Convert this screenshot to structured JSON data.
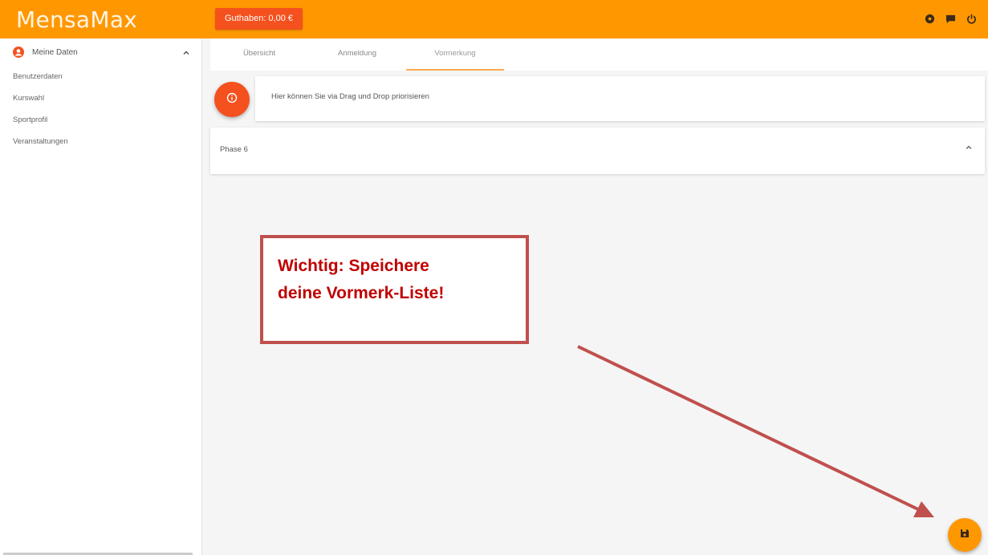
{
  "app": {
    "title": "MensaMax",
    "balance": "Guthaben: 0,00 €"
  },
  "sidebar": {
    "header": "Meine Daten",
    "items": [
      {
        "label": "Benutzerdaten"
      },
      {
        "label": "Kurswahl"
      },
      {
        "label": "Sportprofil"
      },
      {
        "label": "Veranstaltungen"
      }
    ]
  },
  "tabs": [
    {
      "label": "Übersicht"
    },
    {
      "label": "Anmeldung"
    },
    {
      "label": "Vormerkung",
      "active": true
    }
  ],
  "info": {
    "text": "Hier können Sie via Drag und Drop priorisieren"
  },
  "phase": {
    "label": "Phase 6"
  },
  "callout": {
    "line1": "Wichtig: Speichere",
    "line2": "deine Vormerk-Liste!"
  },
  "colors": {
    "primary": "#ff9800",
    "accent": "#f4511e",
    "callout": "#c00000",
    "arrow": "#c0504d"
  },
  "icons": {
    "top": [
      "settings-icon",
      "chat-icon",
      "power-icon"
    ],
    "info": "info-icon",
    "save": "save-icon"
  }
}
